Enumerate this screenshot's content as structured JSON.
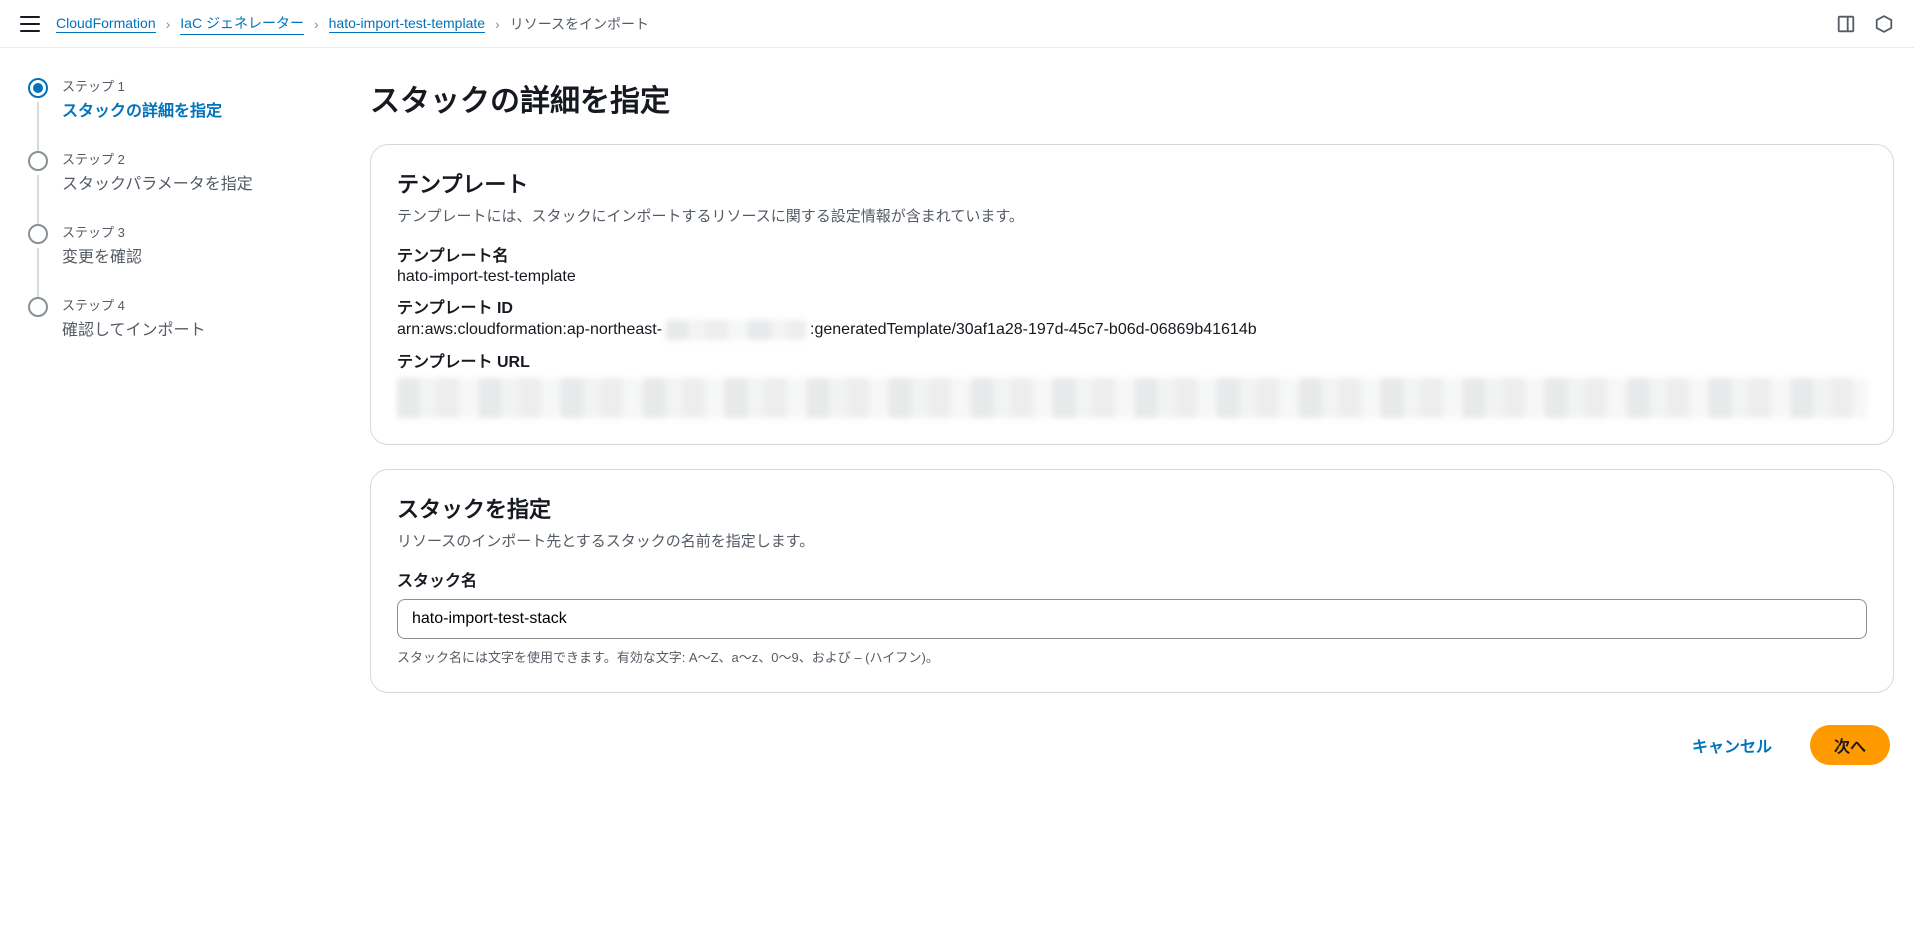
{
  "breadcrumbs": {
    "service": "CloudFormation",
    "generator": "IaC ジェネレーター",
    "template": "hato-import-test-template",
    "current": "リソースをインポート"
  },
  "stepper": {
    "step1_num": "ステップ 1",
    "step1_title": "スタックの詳細を指定",
    "step2_num": "ステップ 2",
    "step2_title": "スタックパラメータを指定",
    "step3_num": "ステップ 3",
    "step3_title": "変更を確認",
    "step4_num": "ステップ 4",
    "step4_title": "確認してインポート"
  },
  "main": {
    "heading": "スタックの詳細を指定"
  },
  "template_panel": {
    "title": "テンプレート",
    "desc": "テンプレートには、スタックにインポートするリソースに関する設定情報が含まれています。",
    "name_label": "テンプレート名",
    "name_value": "hato-import-test-template",
    "id_label": "テンプレート ID",
    "id_prefix": "arn:aws:cloudformation:ap-northeast-",
    "id_suffix": ":generatedTemplate/30af1a28-197d-45c7-b06d-06869b41614b",
    "url_label": "テンプレート URL"
  },
  "stack_panel": {
    "title": "スタックを指定",
    "desc": "リソースのインポート先とするスタックの名前を指定します。",
    "name_label": "スタック名",
    "name_value": "hato-import-test-stack",
    "hint": "スタック名には文字を使用できます。有効な文字: A～Z、a～z、0～9、および – (ハイフン)。"
  },
  "actions": {
    "cancel": "キャンセル",
    "next": "次へ"
  }
}
